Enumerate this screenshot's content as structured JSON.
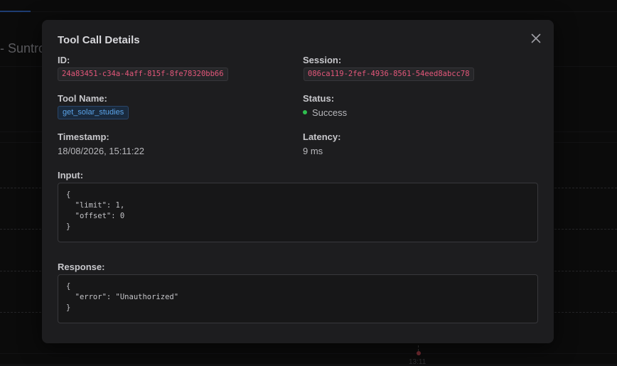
{
  "background": {
    "title_fragment": "- Suntro",
    "chart_time_label": "13:11"
  },
  "modal": {
    "title": "Tool Call Details",
    "close_icon": "close-icon",
    "fields": {
      "id_label": "ID:",
      "id_value": "24a83451-c34a-4aff-815f-8fe78320bb66",
      "session_label": "Session:",
      "session_value": "086ca119-2fef-4936-8561-54eed8abcc78",
      "tool_name_label": "Tool Name:",
      "tool_name_value": "get_solar_studies",
      "status_label": "Status:",
      "status_value": "Success",
      "timestamp_label": "Timestamp:",
      "timestamp_value": "18/08/2026, 15:11:22",
      "latency_label": "Latency:",
      "latency_value": "9 ms"
    },
    "input": {
      "label": "Input:",
      "code": "{\n  \"limit\": 1,\n  \"offset\": 0\n}"
    },
    "response": {
      "label": "Response:",
      "code": "{\n  \"error\": \"Unauthorized\"\n}"
    }
  },
  "colors": {
    "status_success": "#2fbf4f",
    "id_text": "#e3577a",
    "tool_chip_text": "#5aa3e8",
    "modal_bg": "#1d1d1f",
    "page_bg": "#111112"
  }
}
